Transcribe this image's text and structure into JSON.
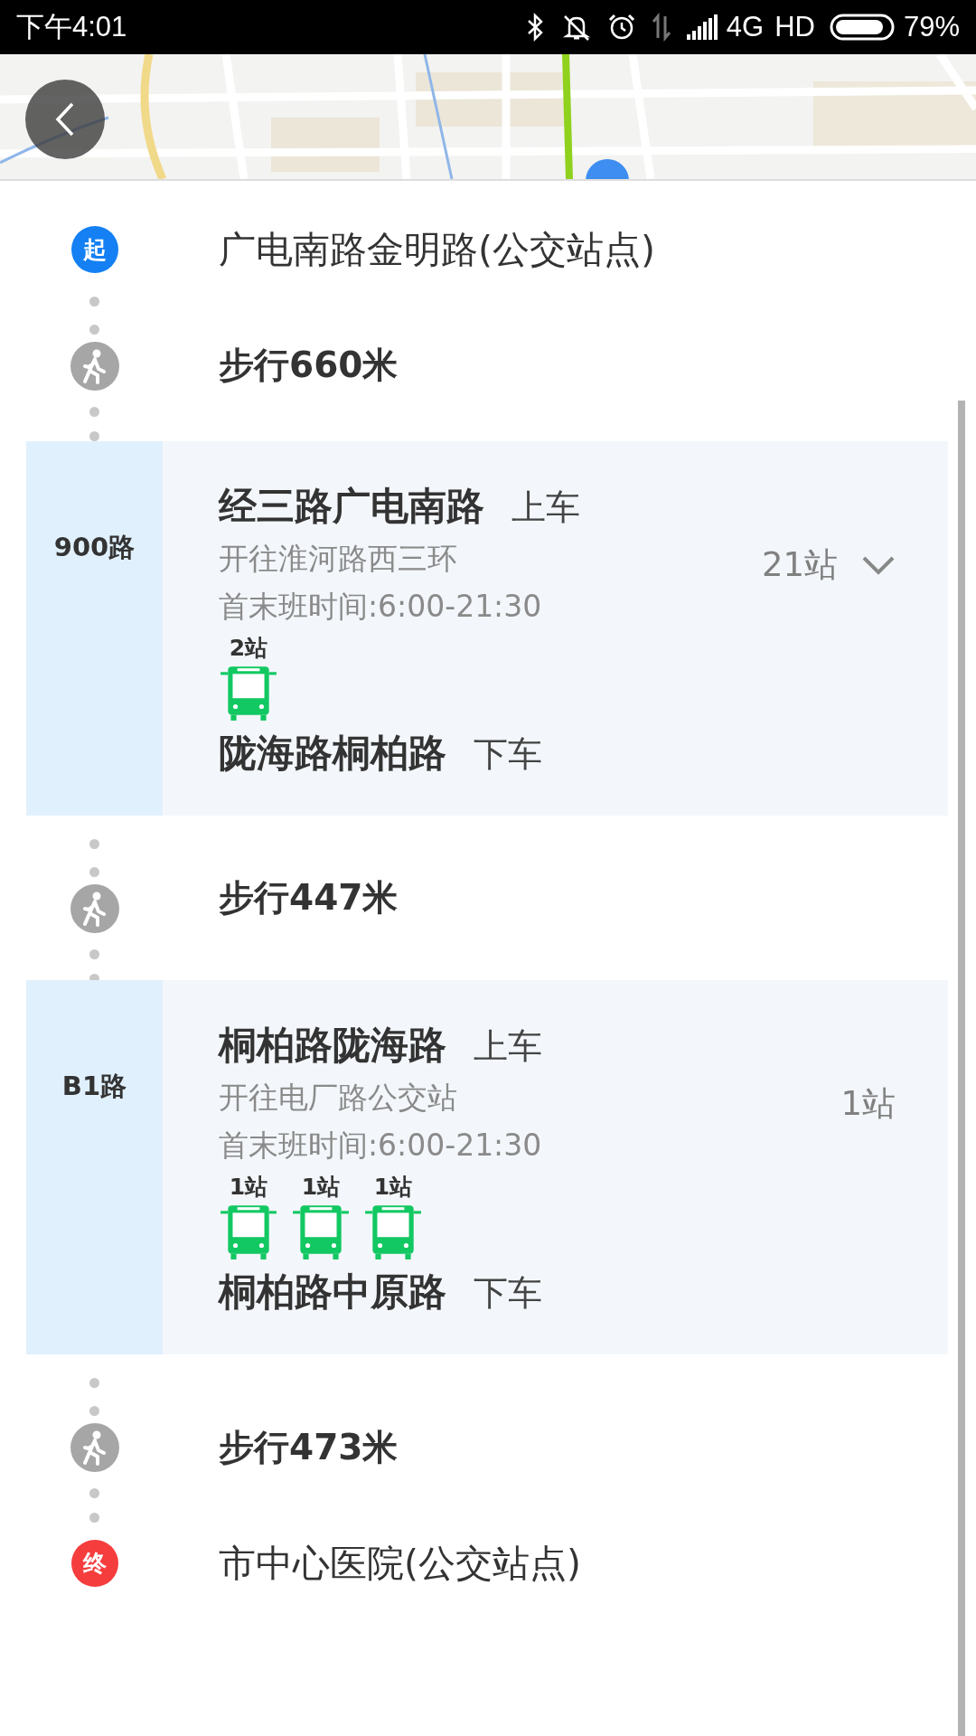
{
  "status_bar": {
    "time": "下午4:01",
    "network": "4G",
    "hd": "HD",
    "battery": "79%"
  },
  "steps": [
    {
      "kind": "start",
      "badge": "起",
      "name": "广电南路金明路(公交站点)"
    },
    {
      "kind": "walk",
      "text": "步行660米"
    },
    {
      "kind": "bus",
      "line": "900路",
      "board_stop": "经三路广电南路",
      "board_label": "上车",
      "direction": "开往淮河路西三环",
      "hours": "首末班时间:6:00-21:30",
      "stop_count": "21站",
      "expandable": true,
      "buses": [
        {
          "label": "2站"
        }
      ],
      "alight_stop": "陇海路桐柏路",
      "alight_label": "下车"
    },
    {
      "kind": "walk",
      "text": "步行447米"
    },
    {
      "kind": "bus",
      "line": "B1路",
      "board_stop": "桐柏路陇海路",
      "board_label": "上车",
      "direction": "开往电厂路公交站",
      "hours": "首末班时间:6:00-21:30",
      "stop_count": "1站",
      "expandable": false,
      "buses": [
        {
          "label": "1站"
        },
        {
          "label": "1站"
        },
        {
          "label": "1站"
        }
      ],
      "alight_stop": "桐柏路中原路",
      "alight_label": "下车"
    },
    {
      "kind": "walk",
      "text": "步行473米"
    },
    {
      "kind": "end",
      "badge": "终",
      "name": "市中心医院(公交站点)"
    }
  ]
}
